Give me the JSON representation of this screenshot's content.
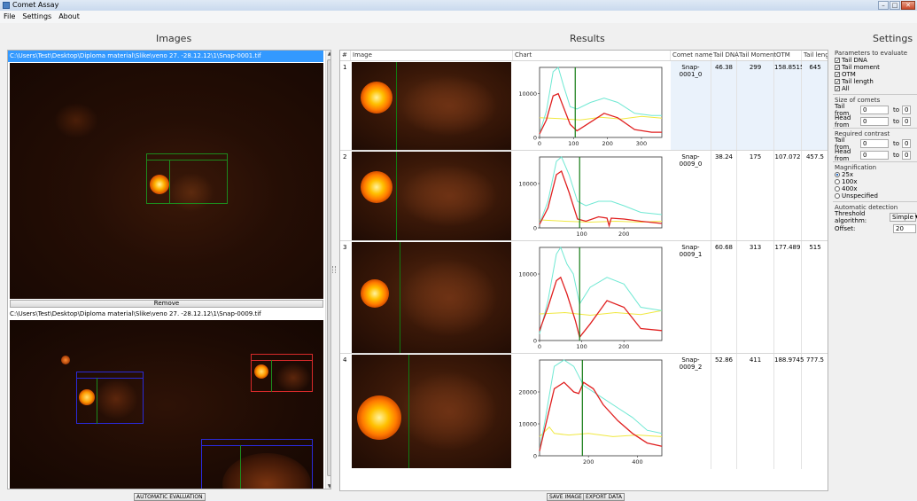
{
  "window": {
    "title": "Comet Assay"
  },
  "menu": [
    "File",
    "Settings",
    "About"
  ],
  "sections": {
    "images": "Images",
    "results": "Results",
    "settings": "Settings"
  },
  "images": [
    {
      "path": "C:\\Users\\Test\\Desktop\\Diploma material\\Slike\\veno 27. -28.12.12\\1\\Snap-0001.tif"
    },
    {
      "path": "C:\\Users\\Test\\Desktop\\Diploma material\\Slike\\veno 27. -28.12.12\\1\\Snap-0009.tif"
    }
  ],
  "remove_label": "Remove",
  "results": {
    "columns": [
      "#",
      "Image",
      "Chart",
      "Comet name",
      "Tail DNA",
      "Tail Moment",
      "OTM",
      "Tail length"
    ],
    "rows": [
      {
        "idx": "1",
        "name": "Snap-0001_0",
        "tail_dna": "46.38",
        "tail_moment": "299",
        "otm": "158.8515",
        "tail_length": "645"
      },
      {
        "idx": "2",
        "name": "Snap-0009_0",
        "tail_dna": "38.24",
        "tail_moment": "175",
        "otm": "107.072",
        "tail_length": "457.5"
      },
      {
        "idx": "3",
        "name": "Snap-0009_1",
        "tail_dna": "60.68",
        "tail_moment": "313",
        "otm": "177.489",
        "tail_length": "515"
      },
      {
        "idx": "4",
        "name": "Snap-0009_2",
        "tail_dna": "52.86",
        "tail_moment": "411",
        "otm": "188.9745",
        "tail_length": "777.5"
      }
    ]
  },
  "charts": [
    {
      "yticks": [
        "10000",
        "0"
      ],
      "xticks": [
        "0",
        "100",
        "200",
        "300"
      ],
      "ymax": 16000,
      "xmax": 360,
      "divider": 105,
      "cyan": [
        [
          0,
          1000
        ],
        [
          20,
          6000
        ],
        [
          40,
          15000
        ],
        [
          55,
          16000
        ],
        [
          70,
          12000
        ],
        [
          90,
          7000
        ],
        [
          110,
          6500
        ],
        [
          150,
          8000
        ],
        [
          190,
          9000
        ],
        [
          230,
          8000
        ],
        [
          280,
          5500
        ],
        [
          330,
          5000
        ],
        [
          360,
          5000
        ]
      ],
      "red": [
        [
          0,
          800
        ],
        [
          20,
          4000
        ],
        [
          40,
          9500
        ],
        [
          55,
          10000
        ],
        [
          70,
          7000
        ],
        [
          90,
          3000
        ],
        [
          110,
          1500
        ],
        [
          140,
          3000
        ],
        [
          190,
          5500
        ],
        [
          230,
          4500
        ],
        [
          280,
          1800
        ],
        [
          330,
          1200
        ],
        [
          360,
          1200
        ]
      ],
      "yellow": [
        [
          0,
          4500
        ],
        [
          60,
          4300
        ],
        [
          120,
          4000
        ],
        [
          180,
          4600
        ],
        [
          240,
          4200
        ],
        [
          300,
          4800
        ],
        [
          360,
          4400
        ]
      ]
    },
    {
      "yticks": [
        "10000",
        "0"
      ],
      "xticks": [
        "100",
        "200"
      ],
      "ymax": 16000,
      "xmax": 290,
      "divider": 95,
      "cyan": [
        [
          0,
          1000
        ],
        [
          20,
          6000
        ],
        [
          40,
          15000
        ],
        [
          52,
          16000
        ],
        [
          70,
          12000
        ],
        [
          90,
          6000
        ],
        [
          110,
          5000
        ],
        [
          140,
          6000
        ],
        [
          170,
          6000
        ],
        [
          200,
          5000
        ],
        [
          240,
          3500
        ],
        [
          290,
          3000
        ]
      ],
      "red": [
        [
          0,
          800
        ],
        [
          20,
          4500
        ],
        [
          40,
          12000
        ],
        [
          52,
          12800
        ],
        [
          70,
          8000
        ],
        [
          90,
          2000
        ],
        [
          110,
          1500
        ],
        [
          140,
          2500
        ],
        [
          160,
          2200
        ],
        [
          165,
          500
        ],
        [
          170,
          2200
        ],
        [
          200,
          2000
        ],
        [
          240,
          1500
        ],
        [
          290,
          1000
        ]
      ],
      "yellow": [
        [
          0,
          1800
        ],
        [
          60,
          1500
        ],
        [
          120,
          1300
        ],
        [
          180,
          1500
        ],
        [
          240,
          1300
        ],
        [
          290,
          1500
        ]
      ]
    },
    {
      "yticks": [
        "10000",
        "0"
      ],
      "xticks": [
        "0",
        "100",
        "200"
      ],
      "ymax": 14000,
      "xmax": 290,
      "divider": 95,
      "cyan": [
        [
          0,
          1000
        ],
        [
          20,
          6000
        ],
        [
          40,
          13000
        ],
        [
          50,
          14000
        ],
        [
          65,
          11500
        ],
        [
          80,
          10000
        ],
        [
          95,
          5500
        ],
        [
          120,
          8000
        ],
        [
          160,
          9500
        ],
        [
          200,
          8500
        ],
        [
          240,
          5000
        ],
        [
          290,
          4500
        ]
      ],
      "red": [
        [
          0,
          1500
        ],
        [
          20,
          5000
        ],
        [
          40,
          9000
        ],
        [
          50,
          9500
        ],
        [
          65,
          7000
        ],
        [
          85,
          3000
        ],
        [
          95,
          500
        ],
        [
          120,
          2500
        ],
        [
          160,
          6000
        ],
        [
          200,
          5000
        ],
        [
          240,
          1800
        ],
        [
          290,
          1500
        ]
      ],
      "yellow": [
        [
          0,
          4000
        ],
        [
          60,
          4200
        ],
        [
          120,
          3800
        ],
        [
          180,
          4200
        ],
        [
          240,
          3900
        ],
        [
          290,
          4500
        ]
      ]
    },
    {
      "yticks": [
        "20000",
        "10000",
        "0"
      ],
      "xticks": [
        "200",
        "400"
      ],
      "ymax": 30000,
      "xmax": 500,
      "divider": 175,
      "cyan": [
        [
          0,
          2000
        ],
        [
          20,
          10000
        ],
        [
          60,
          28000
        ],
        [
          100,
          30000
        ],
        [
          140,
          28000
        ],
        [
          180,
          22000
        ],
        [
          220,
          20000
        ],
        [
          260,
          18000
        ],
        [
          320,
          15000
        ],
        [
          380,
          12000
        ],
        [
          440,
          8000
        ],
        [
          500,
          7000
        ]
      ],
      "red": [
        [
          0,
          1500
        ],
        [
          20,
          8000
        ],
        [
          60,
          21000
        ],
        [
          100,
          23000
        ],
        [
          140,
          20000
        ],
        [
          160,
          19500
        ],
        [
          180,
          23000
        ],
        [
          220,
          21000
        ],
        [
          260,
          16000
        ],
        [
          320,
          11000
        ],
        [
          380,
          7000
        ],
        [
          440,
          4000
        ],
        [
          500,
          3000
        ]
      ],
      "yellow": [
        [
          0,
          6000
        ],
        [
          40,
          9000
        ],
        [
          60,
          7000
        ],
        [
          120,
          6500
        ],
        [
          200,
          7000
        ],
        [
          300,
          6000
        ],
        [
          400,
          6500
        ],
        [
          500,
          6000
        ]
      ]
    }
  ],
  "settings": {
    "params_title": "Parameters to evaluate",
    "params": [
      "Tail DNA",
      "Tail moment",
      "OTM",
      "Tail length",
      "All"
    ],
    "size_title": "Size of comets",
    "tail_from": "Tail from",
    "head_from": "Head from",
    "to": "to",
    "size_tail_from": "0",
    "size_tail_to": "0",
    "size_head_from": "0",
    "size_head_to": "0",
    "contrast_title": "Required contrast",
    "contrast_tail_from": "0",
    "contrast_tail_to": "0",
    "contrast_head_from": "0",
    "contrast_head_to": "0",
    "magnification_title": "Magnification",
    "magnifications": [
      "25x",
      "100x",
      "400x",
      "Unspecified"
    ],
    "auto_title": "Automatic detection",
    "threshold_label": "Threshold algorithm:",
    "threshold_value": "Simple",
    "offset_label": "Offset:",
    "offset_value": "20"
  },
  "buttons": {
    "auto_eval": "AUTOMATIC EVALUATION",
    "save_image": "SAVE IMAGE",
    "export_data": "EXPORT DATA"
  },
  "colors": {
    "cyan": "#6fe8d3",
    "red": "#e02020",
    "yellow": "#f0e840",
    "divider": "#117a11",
    "selection": "#3399ff"
  }
}
